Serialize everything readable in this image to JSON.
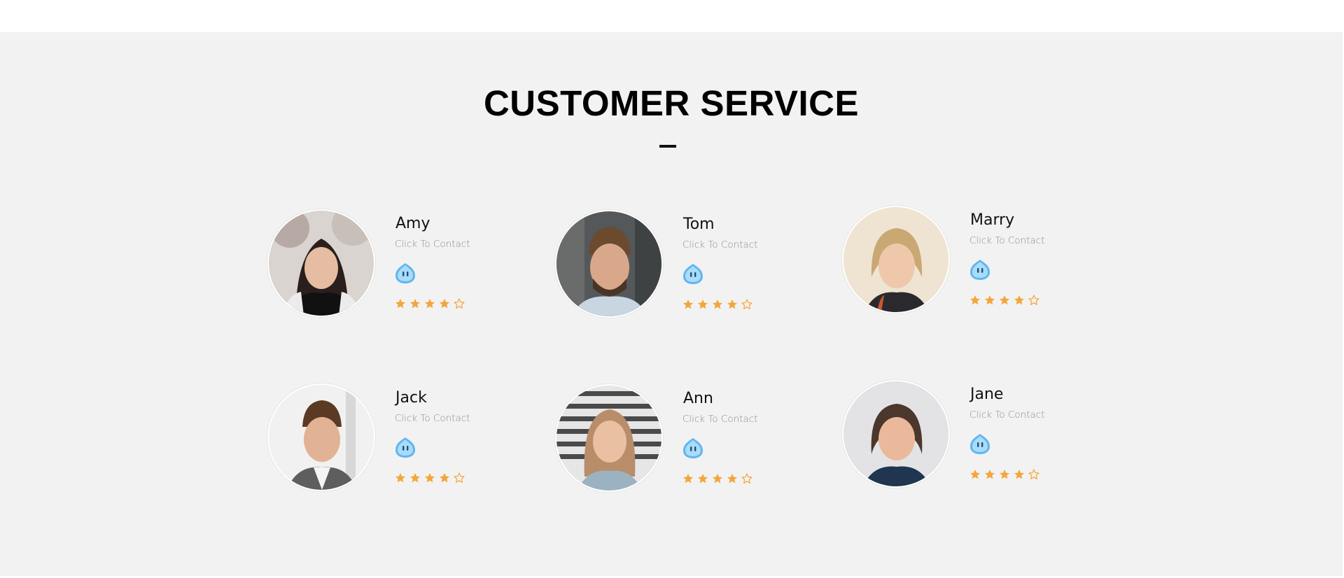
{
  "section": {
    "title": "CUSTOMER SERVICE"
  },
  "colors": {
    "background": "#f2f2f2",
    "star": "#f4a63a",
    "chat_icon": "#5fb6ef"
  },
  "contacts": [
    {
      "name": "Amy",
      "link_label": "Click To Contact",
      "chat_icon": "qq-chat-icon",
      "rating": 4,
      "rating_max": 5
    },
    {
      "name": "Tom",
      "link_label": "Click To Contact",
      "chat_icon": "qq-chat-icon",
      "rating": 4,
      "rating_max": 5
    },
    {
      "name": "Marry",
      "link_label": "Click To Contact",
      "chat_icon": "qq-chat-icon",
      "rating": 4,
      "rating_max": 5
    },
    {
      "name": "Jack",
      "link_label": "Click To Contact",
      "chat_icon": "qq-chat-icon",
      "rating": 4,
      "rating_max": 5
    },
    {
      "name": "Ann",
      "link_label": "Click To Contact",
      "chat_icon": "qq-chat-icon",
      "rating": 4,
      "rating_max": 5
    },
    {
      "name": "Jane",
      "link_label": "Click To Contact",
      "chat_icon": "qq-chat-icon",
      "rating": 4,
      "rating_max": 5
    }
  ]
}
